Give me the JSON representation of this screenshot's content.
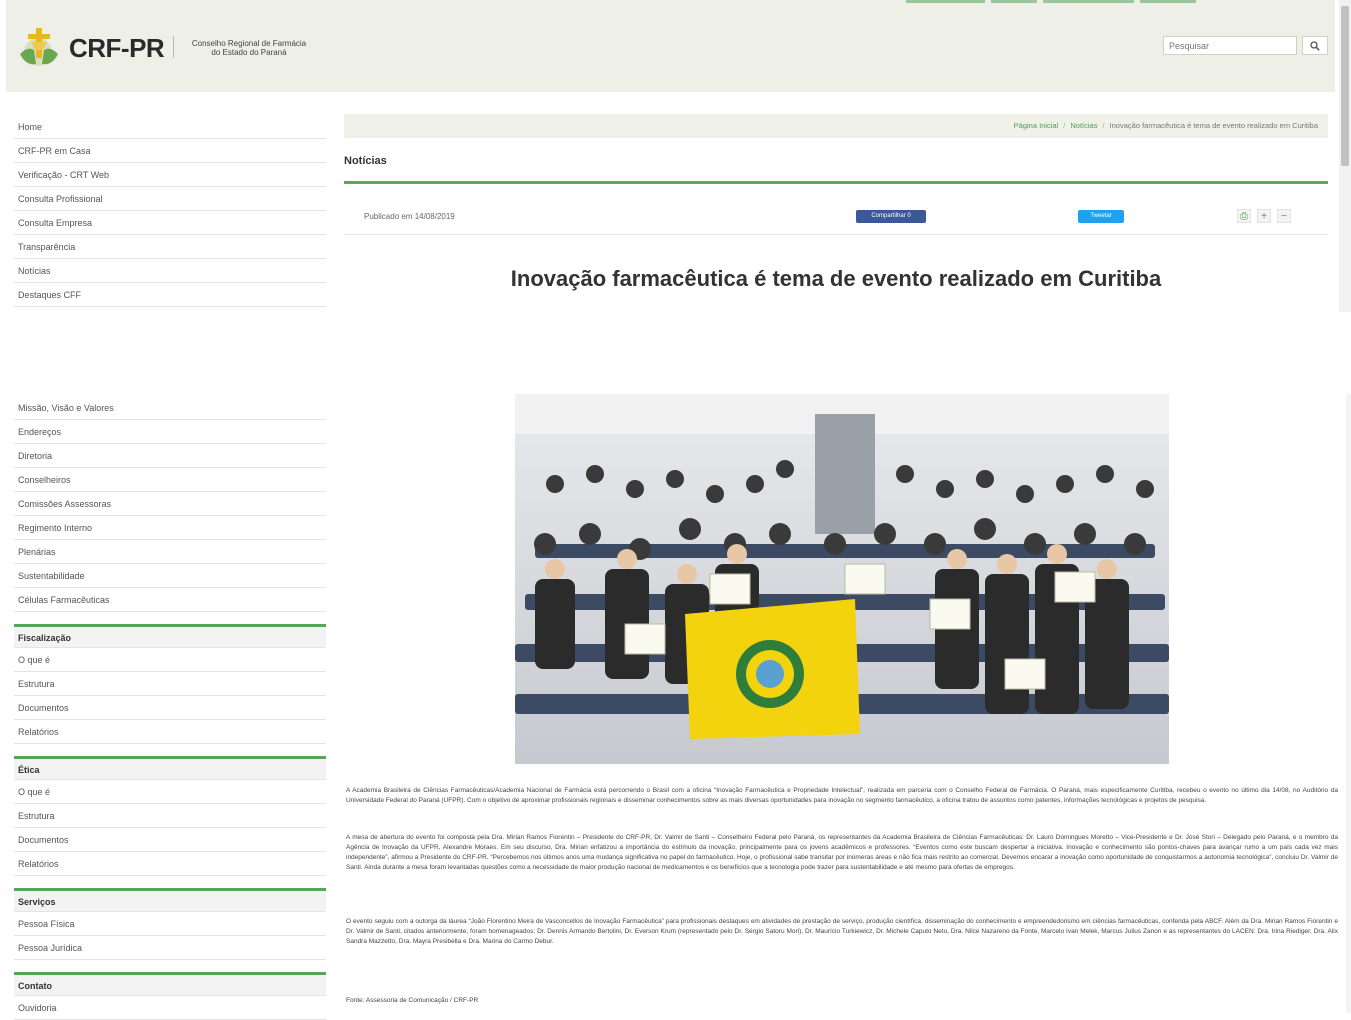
{
  "header": {
    "brand": "CRF-PR",
    "subtitle_line1": "Conselho Regional de Farmácia",
    "subtitle_line2": "do Estado do Paraná",
    "search_placeholder": "Pesquisar"
  },
  "sidebar": {
    "menu_top": [
      "Home",
      "CRF-PR em Casa",
      "Verificação - CRT Web",
      "Consulta Profissional",
      "Consulta Empresa",
      "Transparência",
      "Notícias",
      "Destaques CFF"
    ],
    "menu_institutional": [
      "Missão, Visão e Valores",
      "Endereços",
      "Diretoria",
      "Conselheiros",
      "Comissões Assessoras",
      "Regimento Interno",
      "Plenárias",
      "Sustentabilidade",
      "Células Farmacêuticas"
    ],
    "sections": [
      {
        "title": "Fiscalização",
        "items": [
          "O que é",
          "Estrutura",
          "Documentos",
          "Relatórios"
        ]
      },
      {
        "title": "Ética",
        "items": [
          "O que é",
          "Estrutura",
          "Documentos",
          "Relatórios"
        ]
      },
      {
        "title": "Serviços",
        "items": [
          "Pessoa Física",
          "Pessoa Jurídica"
        ]
      },
      {
        "title": "Contato",
        "items": [
          "Ouvidoria"
        ]
      }
    ]
  },
  "breadcrumb": {
    "home": "Página Inicial",
    "section": "Notícias",
    "current": "Inovação farmacêutica é tema de evento realizado em Curitiba"
  },
  "section_title": "Notícias",
  "article": {
    "published": "Publicado em 14/08/2019",
    "share_facebook": "Compartilhar 0",
    "share_twitter": "Tweetar",
    "tool_icons": [
      "print-icon",
      "zoom-in-icon",
      "zoom-out-icon"
    ],
    "headline": "Inovação farmacêutica é tema de evento realizado em Curitiba",
    "paragraphs": [
      "A Academia Brasileira de Ciências Farmacêuticas/Academia Nacional de Farmácia está percorrendo o Brasil com a oficina “Inovação Farmacêutica e Propriedade Intelectual”, realizada em parceria com o Conselho Federal de Farmácia. O Paraná, mais especificamente Curitiba, recebeu o evento no último dia 14/08, no Auditório da Universidade Federal do Paraná (UFPR). Com o objetivo de aproximar profissionais regionais e disseminar conhecimentos sobre as mais diversas oportunidades para inovação no segmento farmacêutico, a oficina tratou de assuntos como patentes, informações tecnológicas e projetos de pesquisa.",
      "A mesa de abertura do evento foi composta pela Dra. Mirian Ramos Fiorentin – Presidente do CRF-PR, Dr. Valmir de Santi – Conselheiro Federal pelo Paraná, os representantes da Academia Brasileira de Ciências Farmacêuticas: Dr. Lauro Domingues Moretto – Vice-Presidente e Dr. José Stori – Delegado pelo Paraná, e o membro da Agência de Inovação da UFPR, Alexandre Moraes. Em seu discurso, Dra. Mirian enfatizou a importância do estímulo da inovação, principalmente para os jovens acadêmicos e professores. “Eventos como este buscam despertar a iniciativa. Inovação e conhecimento são pontos-chaves para avançar rumo a um país cada vez mais independente”, afirmou a Presidente do CRF-PR. “Percebemos nos últimos anos uma mudança significativa no papel do farmacêutico. Hoje, o profissional sabe transitar por inúmeras áreas e não fica mais restrito ao comercial. Devemos encarar a inovação como oportunidade de conquistarmos a autonomia tecnológica”, concluiu Dr. Valmir de Santi. Ainda durante a mesa foram levantadas questões como a necessidade de maior produção nacional de medicamentos e os benefícios que a tecnologia pode trazer para sustentabilidade e até mesmo para ofertas de empregos.",
      "O evento seguiu com a outorga da láurea “João Florentino Meira de Vasconcellos de Inovação Farmacêutica” para profissionais destaques em atividades de prestação de serviço, produção científica, disseminação do conhecimento e empreendedorismo em ciências farmacêuticas, conferida pela ABCF. Além da Dra. Mirian Ramos Fiorentin e Dr. Valmir de Santi, citados anteriormente, foram homenageados: Dr. Dennis Armando Bertolini, Dr. Everson Krum (representado pelo Dr. Sérgio Satoru Mori), Dr. Maurício Turkiewicz, Dr. Michele Caputo Neto, Dra. Nilce Nazareno da Fonte, Marcelo Ivan Melek, Marcus Julius Zanon e as representantes do LACEN: Dra. Irina Riediger, Dra. Alix Sandra Mazzetto, Dra. Mayra Presibella e Dra. Marina do Carmo Debur."
    ],
    "source": "Fonte: Assessoria de Comunicação / CRF-PR"
  },
  "colors": {
    "accent_green": "#5ba65b",
    "header_bg": "#eef0e7",
    "facebook": "#3b5998",
    "twitter": "#1da1f2",
    "flag_yellow": "#f3d20e"
  }
}
